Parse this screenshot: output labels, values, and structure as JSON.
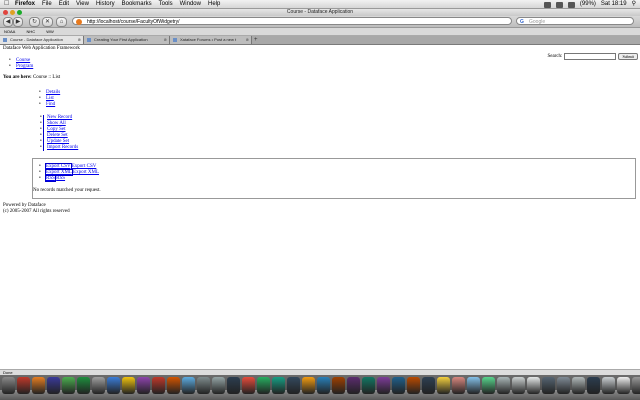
{
  "menubar": {
    "apple": "",
    "items": [
      "Firefox",
      "File",
      "Edit",
      "View",
      "History",
      "Bookmarks",
      "Tools",
      "Window",
      "Help"
    ],
    "battery": "(99%)",
    "clock": "Sat 18:19"
  },
  "window": {
    "title": "Course - Dataface Application"
  },
  "toolbar": {
    "back": "◀",
    "forward": "▶",
    "reload": "↻",
    "stop": "✕",
    "home": "⌂",
    "url": "http://localhost/course/FacultyOfWidgetry/",
    "search_placeholder": "Google",
    "search_engine_icon": "G"
  },
  "bookmarks": [
    "NOAA",
    "NHC",
    "WW"
  ],
  "tabs": [
    {
      "label": "Course - Dataface Application",
      "active": true
    },
    {
      "label": "Creating Your First Application",
      "active": false
    },
    {
      "label": "Xataface Forums • Post a new t",
      "active": false
    }
  ],
  "tab_add": "+",
  "page": {
    "app_title": "Dataface Web Application Framework",
    "search_label": "Search:",
    "search_button": "Submit",
    "tables": [
      "Course",
      "Program"
    ],
    "breadcrumb_label": "You are here:",
    "breadcrumb_path": "Course :: List",
    "view_tabs": [
      "Details",
      "List",
      "Find"
    ],
    "actions": [
      "New Record",
      "Show All",
      "Copy Set",
      "Delete Set",
      "Update Set",
      "Import Records"
    ],
    "exports": [
      {
        "sel": "Export CSV",
        "label": "Export CSV"
      },
      {
        "sel": "Export XML",
        "label": "Export XML"
      },
      {
        "sel": "RSS",
        "label": "RSS"
      }
    ],
    "no_records": "No records matched your request.",
    "footer_line1": "Powered by Dataface",
    "footer_line2": "(c) 2005-2007 All rights reserved"
  },
  "statusbar": {
    "text": "Done"
  },
  "dock": {
    "icon_colors": [
      "#8a8a8a",
      "#c0392b",
      "#e67e22",
      "#3a3a9a",
      "#4caf50",
      "#1e8e3e",
      "#a0a0a0",
      "#3b7dd8",
      "#f1c40f",
      "#8e44ad",
      "#c0392b",
      "#d35400",
      "#5dade2",
      "#7f8c8d",
      "#95a5a6",
      "#2c3e50",
      "#e74c3c",
      "#27ae60",
      "#16a085",
      "#34495e",
      "#f39c12",
      "#2980b9",
      "#a04000",
      "#5b2c6f",
      "#117864",
      "#7d3c98",
      "#1f618d",
      "#ba4a00",
      "#2e4053",
      "#f4d03f",
      "#d98880",
      "#85c1e9",
      "#58d68d",
      "#aab7b8",
      "#ccd1d1",
      "#e5e8e8",
      "#566573",
      "#808b96",
      "#b2babb",
      "#2c3e50",
      "#cacfd2",
      "#eeeeee",
      "#999999"
    ]
  }
}
